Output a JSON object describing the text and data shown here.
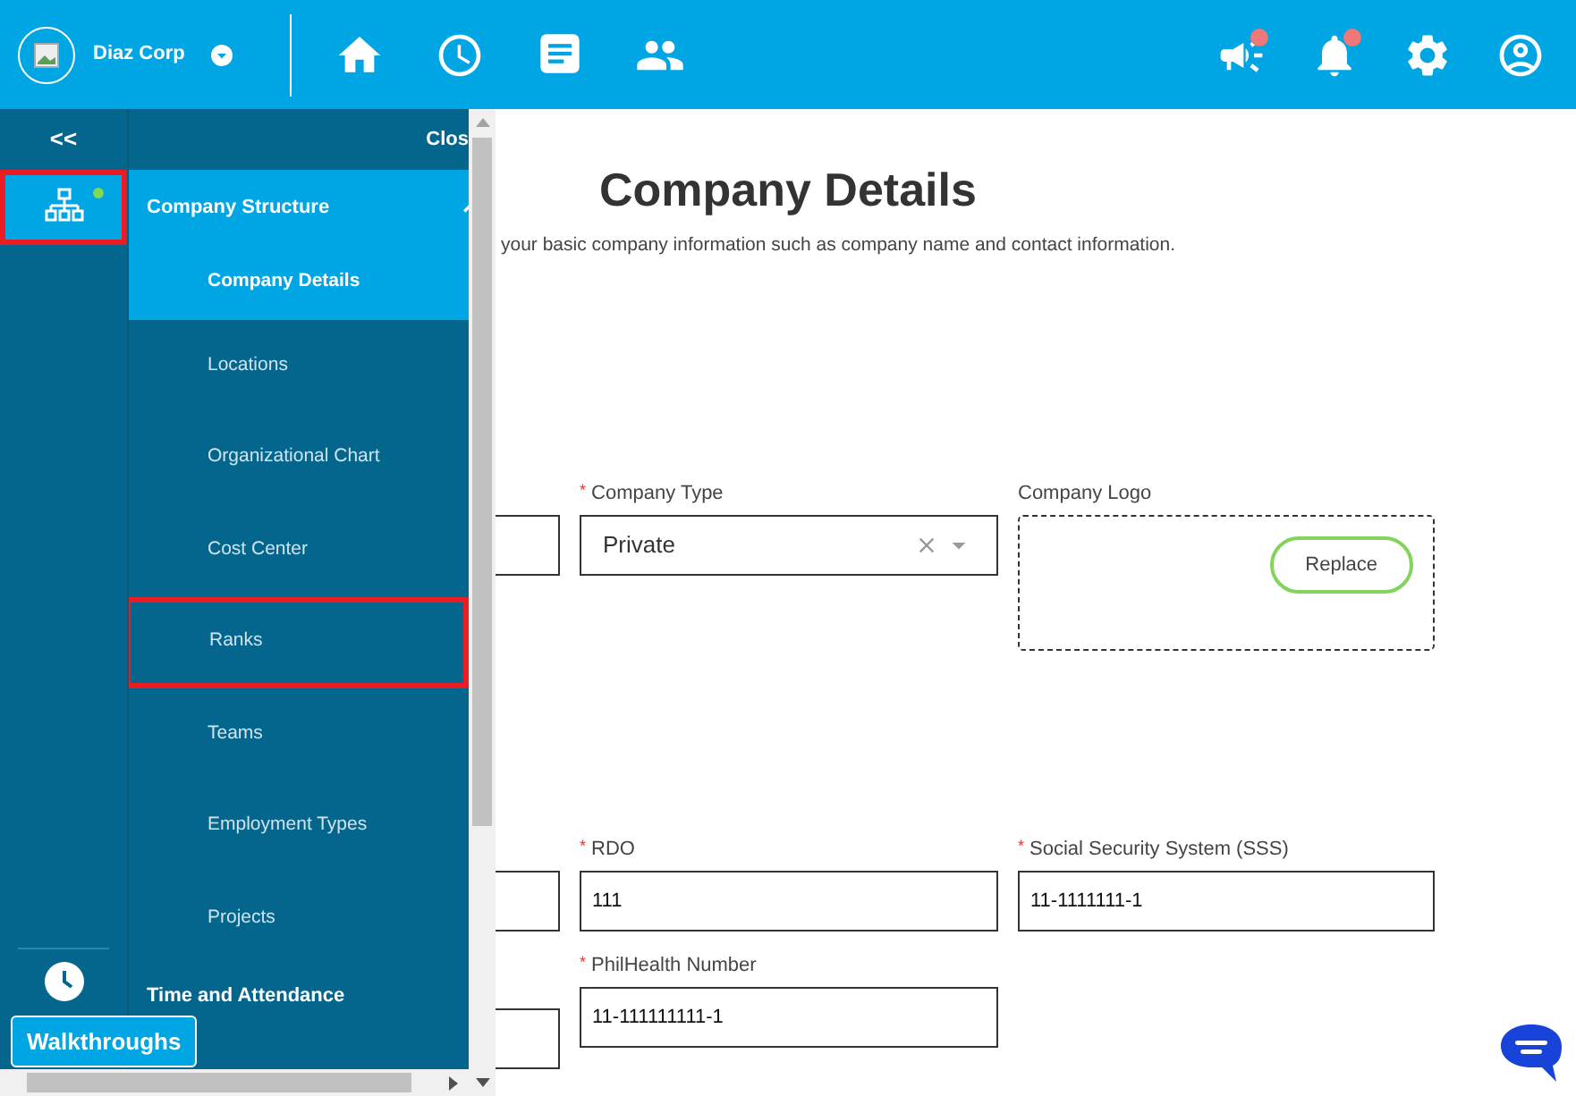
{
  "topbar": {
    "company": "Diaz Corp",
    "nav": [
      {
        "kind": "home"
      },
      {
        "kind": "clock"
      },
      {
        "kind": "document"
      },
      {
        "kind": "people"
      }
    ],
    "alerts": [
      {
        "kind": "megaphone",
        "unread": true
      },
      {
        "kind": "bell",
        "unread": true
      },
      {
        "kind": "gear",
        "unread": false
      },
      {
        "kind": "user",
        "unread": false
      }
    ]
  },
  "rail": {
    "collapse": "<<",
    "items": [
      {
        "kind": "org",
        "selected": true,
        "highlighted": true,
        "indicator": true
      },
      {
        "kind": "clock",
        "selected": false,
        "highlighted": false,
        "indicator": false
      }
    ]
  },
  "drawer": {
    "close": "Clos",
    "sections": [
      {
        "label": "Company Structure",
        "selected": true,
        "expanded": true,
        "children": [
          {
            "label": "Company Details",
            "selected": true,
            "highlighted": false
          },
          {
            "label": "Locations",
            "selected": false,
            "highlighted": false
          },
          {
            "label": "Organizational Chart",
            "selected": false,
            "highlighted": false
          },
          {
            "label": "Cost Center",
            "selected": false,
            "highlighted": false
          },
          {
            "label": "Ranks",
            "selected": false,
            "highlighted": true
          },
          {
            "label": "Teams",
            "selected": false,
            "highlighted": false
          },
          {
            "label": "Employment Types",
            "selected": false,
            "highlighted": false
          },
          {
            "label": "Projects",
            "selected": false,
            "highlighted": false
          }
        ]
      },
      {
        "label": "Time and Attendance",
        "selected": false,
        "expanded": false
      }
    ]
  },
  "walkthroughs": "Walkthroughs",
  "page": {
    "title": "Company Details",
    "subtitle": "your basic company information such as company name and contact information."
  },
  "form_rows": [
    [
      {
        "kind": "cut"
      },
      {
        "kind": "select",
        "label": "Company Type",
        "required_mark": "*",
        "value": "Private"
      },
      {
        "kind": "logo",
        "label": "Company Logo",
        "button": "Replace"
      }
    ],
    [
      {
        "kind": "cut"
      },
      {
        "kind": "input",
        "label": "RDO",
        "required_mark": "*",
        "value": "111"
      },
      {
        "kind": "input",
        "label": "Social Security System (SSS)",
        "required_mark": "*",
        "value": "11-1111111-1"
      }
    ],
    [
      {
        "kind": "cut_low"
      },
      {
        "kind": "input",
        "label": "PhilHealth Number",
        "required_mark": "*",
        "value": "11-111111111-1"
      }
    ]
  ]
}
